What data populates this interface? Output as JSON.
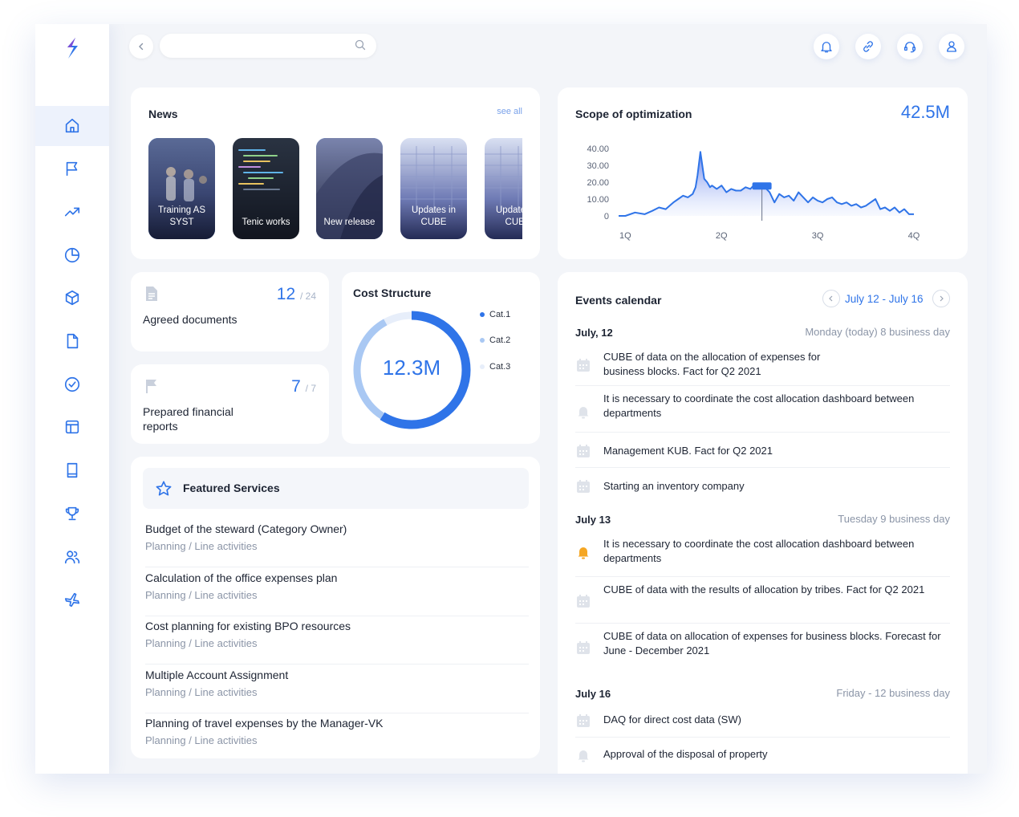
{
  "brand": {
    "logo": "lightning-s-logo"
  },
  "sidebar": {
    "items": [
      {
        "icon": "home-icon",
        "active": true
      },
      {
        "icon": "flag-icon"
      },
      {
        "icon": "trend-icon"
      },
      {
        "icon": "pie-chart-icon"
      },
      {
        "icon": "cube-icon"
      },
      {
        "icon": "document-icon"
      },
      {
        "icon": "check-circle-icon"
      },
      {
        "icon": "layout-icon"
      },
      {
        "icon": "book-icon"
      },
      {
        "icon": "trophy-icon"
      },
      {
        "icon": "users-icon"
      },
      {
        "icon": "airplane-icon"
      }
    ]
  },
  "topbar": {
    "search_value": "",
    "icons": [
      "bell-icon",
      "link-icon",
      "headset-icon",
      "user-icon"
    ]
  },
  "news": {
    "title": "News",
    "see_all": "see all",
    "items": [
      {
        "label": "Training AS SYST",
        "color": "#3a4a78"
      },
      {
        "label": "Tenic works",
        "color": "#1f2736"
      },
      {
        "label": "New release",
        "color": "#5a6490"
      },
      {
        "label": "Updates in CUBE",
        "color": "#b8c3e6"
      },
      {
        "label": "Updates in CUBE",
        "color": "#b8c3e6"
      }
    ]
  },
  "scope": {
    "title": "Scope of optimization",
    "value": "42.5M"
  },
  "chart_data": {
    "type": "area",
    "title": "Scope of optimization",
    "xlabel": "",
    "ylabel": "",
    "y_ticks": [
      "40.00",
      "30.00",
      "20.00",
      "10.00",
      "0"
    ],
    "x_ticks": [
      "1Q",
      "2Q",
      "3Q",
      "4Q"
    ],
    "ylim": [
      0,
      40
    ],
    "xlim": [
      0.93,
      4.05
    ],
    "grid": false,
    "color": "#2f74e8",
    "marker_x": 2.42,
    "x": [
      0.93,
      1.0,
      1.1,
      1.2,
      1.28,
      1.35,
      1.42,
      1.5,
      1.55,
      1.6,
      1.65,
      1.7,
      1.73,
      1.75,
      1.78,
      1.82,
      1.85,
      1.88,
      1.9,
      1.95,
      2.0,
      2.05,
      2.1,
      2.15,
      2.2,
      2.25,
      2.3,
      2.35,
      2.4,
      2.45,
      2.5,
      2.55,
      2.6,
      2.65,
      2.7,
      2.75,
      2.8,
      2.85,
      2.9,
      2.95,
      3.0,
      3.05,
      3.1,
      3.15,
      3.2,
      3.25,
      3.3,
      3.35,
      3.4,
      3.45,
      3.5,
      3.55,
      3.6,
      3.65,
      3.7,
      3.75,
      3.8,
      3.85,
      3.9,
      3.95,
      4.0
    ],
    "values": [
      0,
      0,
      2,
      1,
      3,
      5,
      4,
      8,
      10,
      12,
      11,
      13,
      17,
      24,
      38,
      22,
      20,
      17,
      18,
      16,
      18,
      14,
      16,
      15,
      15,
      17,
      16,
      19,
      18,
      17,
      14,
      8,
      13,
      11,
      12,
      9,
      14,
      11,
      8,
      11,
      9,
      8,
      10,
      11,
      8,
      7,
      8,
      6,
      7,
      5,
      6,
      8,
      10,
      4,
      5,
      3,
      5,
      2,
      4,
      1,
      1
    ]
  },
  "agreed": {
    "value": "12",
    "total": "/ 24",
    "label": "Agreed documents"
  },
  "reports": {
    "value": "7",
    "total": "/ 7",
    "label": "Prepared financial reports"
  },
  "cost": {
    "title": "Cost Structure",
    "center": "12.3M",
    "legend": [
      {
        "name": "Cat.1",
        "color": "#2f74e8",
        "share": 0.59
      },
      {
        "name": "Cat.2",
        "color": "#a9c8f3",
        "share": 0.33
      },
      {
        "name": "Cat.3",
        "color": "#e7eefa",
        "share": 0.08
      }
    ]
  },
  "featured": {
    "title": "Featured Services",
    "items": [
      {
        "name": "Budget of the steward (Category Owner)",
        "category": "Planning / Line activities"
      },
      {
        "name": "Calculation of the office expenses plan",
        "category": "Planning / Line activities"
      },
      {
        "name": "Cost planning for existing BPO resources",
        "category": "Planning / Line activities"
      },
      {
        "name": "Multiple Account Assignment",
        "category": "Planning / Line activities"
      },
      {
        "name": "Planning of travel expenses by the Manager-VK",
        "category": "Planning / Line activities"
      }
    ]
  },
  "events": {
    "title": "Events calendar",
    "range": "July 12 - July 16",
    "days": [
      {
        "date": "July, 12",
        "info": "Monday (today) 8 business day",
        "items": [
          {
            "icon": "calendar-icon",
            "text": "CUBE of data on the allocation of expenses for business blocks. Fact for Q2 2021"
          },
          {
            "icon": "bell-icon",
            "text": "It is necessary to coordinate the cost allocation dashboard between departments"
          },
          {
            "icon": "calendar-icon",
            "text": "Management KUB. Fact for Q2 2021"
          },
          {
            "icon": "calendar-icon",
            "text": "Starting an inventory company"
          }
        ]
      },
      {
        "date": "July 13",
        "info": "Tuesday 9 business day",
        "items": [
          {
            "icon": "bell-alert-icon",
            "text": "It is necessary to coordinate the cost allocation dashboard between departments"
          },
          {
            "icon": "calendar-icon",
            "text": "CUBE of data with the results of allocation by tribes. Fact for Q2 2021"
          },
          {
            "icon": "calendar-icon",
            "text": "CUBE of data on allocation of expenses for business blocks. Forecast for June - December 2021"
          }
        ]
      },
      {
        "date": "July 16",
        "info": "Friday - 12 business day",
        "items": [
          {
            "icon": "calendar-icon",
            "text": "DAQ for direct cost data (SW)"
          },
          {
            "icon": "bell-icon",
            "text": "Approval of the disposal of property"
          }
        ]
      }
    ]
  }
}
